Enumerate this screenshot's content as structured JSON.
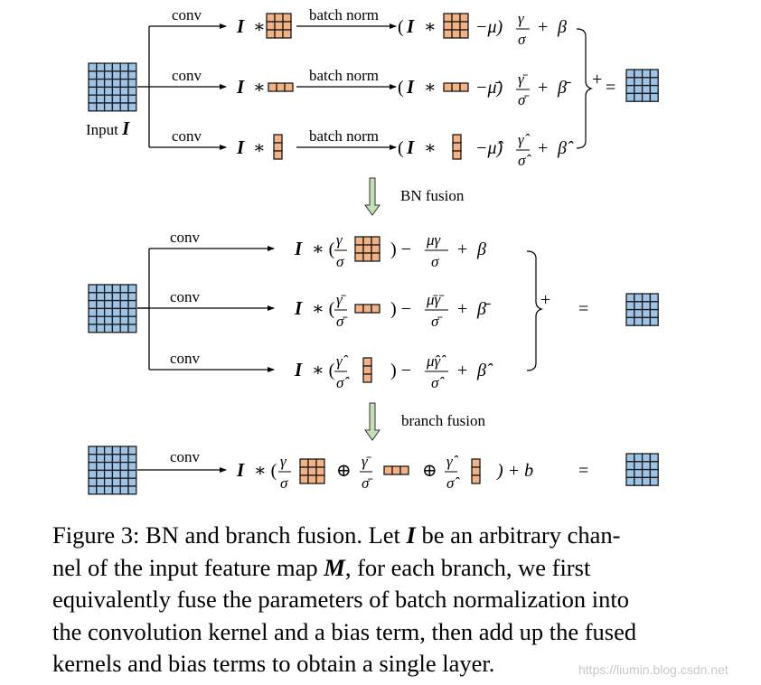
{
  "figure": {
    "colors": {
      "input_fill": "#9dc3e6",
      "kernel_fill": "#f4b183",
      "arrow_fill": "#c5e0b4",
      "grid_stroke": "#1a1a1a"
    },
    "section1": {
      "input_label_text": "Input",
      "input_label_symbol": "I",
      "branches": [
        {
          "kernel": "3x3",
          "conv_label": "conv",
          "bn_label": "batch norm",
          "input_symbol": "I",
          "op": "∗",
          "mean": "−μ)",
          "gamma": "γ",
          "sigma": "σ",
          "plus": "+",
          "beta": "β"
        },
        {
          "kernel": "1x3",
          "conv_label": "conv",
          "bn_label": "batch norm",
          "input_symbol": "I",
          "op": "∗",
          "mean": "−μ̄)",
          "gamma": "γ̄",
          "sigma": "σ̄",
          "plus": "+",
          "beta": "β̄"
        },
        {
          "kernel": "3x1",
          "conv_label": "conv",
          "bn_label": "batch norm",
          "input_symbol": "I",
          "op": "∗",
          "mean": "−μ̂)",
          "gamma": "γ̂",
          "sigma": "σ̂",
          "plus": "+",
          "beta": "β̂"
        }
      ],
      "sum_symbol": "+",
      "equals_symbol": "="
    },
    "arrow1_label": "BN fusion",
    "section2": {
      "branches": [
        {
          "conv_label": "conv",
          "prefix": "I",
          "op": "∗ (",
          "gamma": "γ",
          "sigma": "σ",
          "close": ") −",
          "bias_num": "μγ",
          "bias_den": "σ",
          "plus": "+",
          "beta": "β"
        },
        {
          "conv_label": "conv",
          "prefix": "I",
          "op": "∗ (",
          "gamma": "γ̄",
          "sigma": "σ̄",
          "close": ") −",
          "bias_num": "μ̄γ̄",
          "bias_den": "σ̄",
          "plus": "+",
          "beta": "β̄"
        },
        {
          "conv_label": "conv",
          "prefix": "I",
          "op": "∗ (",
          "gamma": "γ̂",
          "sigma": "σ̂",
          "close": ") −",
          "bias_num": "μ̂γ̂",
          "bias_den": "σ̂",
          "plus": "+",
          "beta": "β̂"
        }
      ],
      "sum_symbol": "+",
      "equals_symbol": "="
    },
    "arrow2_label": "branch fusion",
    "section3": {
      "conv_label": "conv",
      "prefix": "I",
      "op": "∗ (",
      "g1": "γ",
      "s1": "σ",
      "oplus1": "⊕",
      "g2": "γ̄",
      "s2": "σ̄",
      "oplus2": "⊕",
      "g3": "γ̂",
      "s3": "σ̂",
      "tail": ") + b",
      "equals_symbol": "="
    }
  },
  "caption": {
    "lines": [
      {
        "pre": "Figure 3: BN and branch fusion. Let ",
        "sym": "I",
        "post": " be an arbitrary chan-"
      },
      {
        "pre": "nel of the input feature map ",
        "sym": "M",
        "post": ", for each branch, we first"
      },
      {
        "pre": "equivalently fuse the parameters of batch normalization into",
        "sym": "",
        "post": ""
      },
      {
        "pre": "the convolution kernel and a bias term, then add up the fused",
        "sym": "",
        "post": ""
      },
      {
        "pre": "kernels and bias terms to obtain a single layer.",
        "sym": "",
        "post": ""
      }
    ]
  },
  "watermark": "https://liumin.blog.csdn.net"
}
